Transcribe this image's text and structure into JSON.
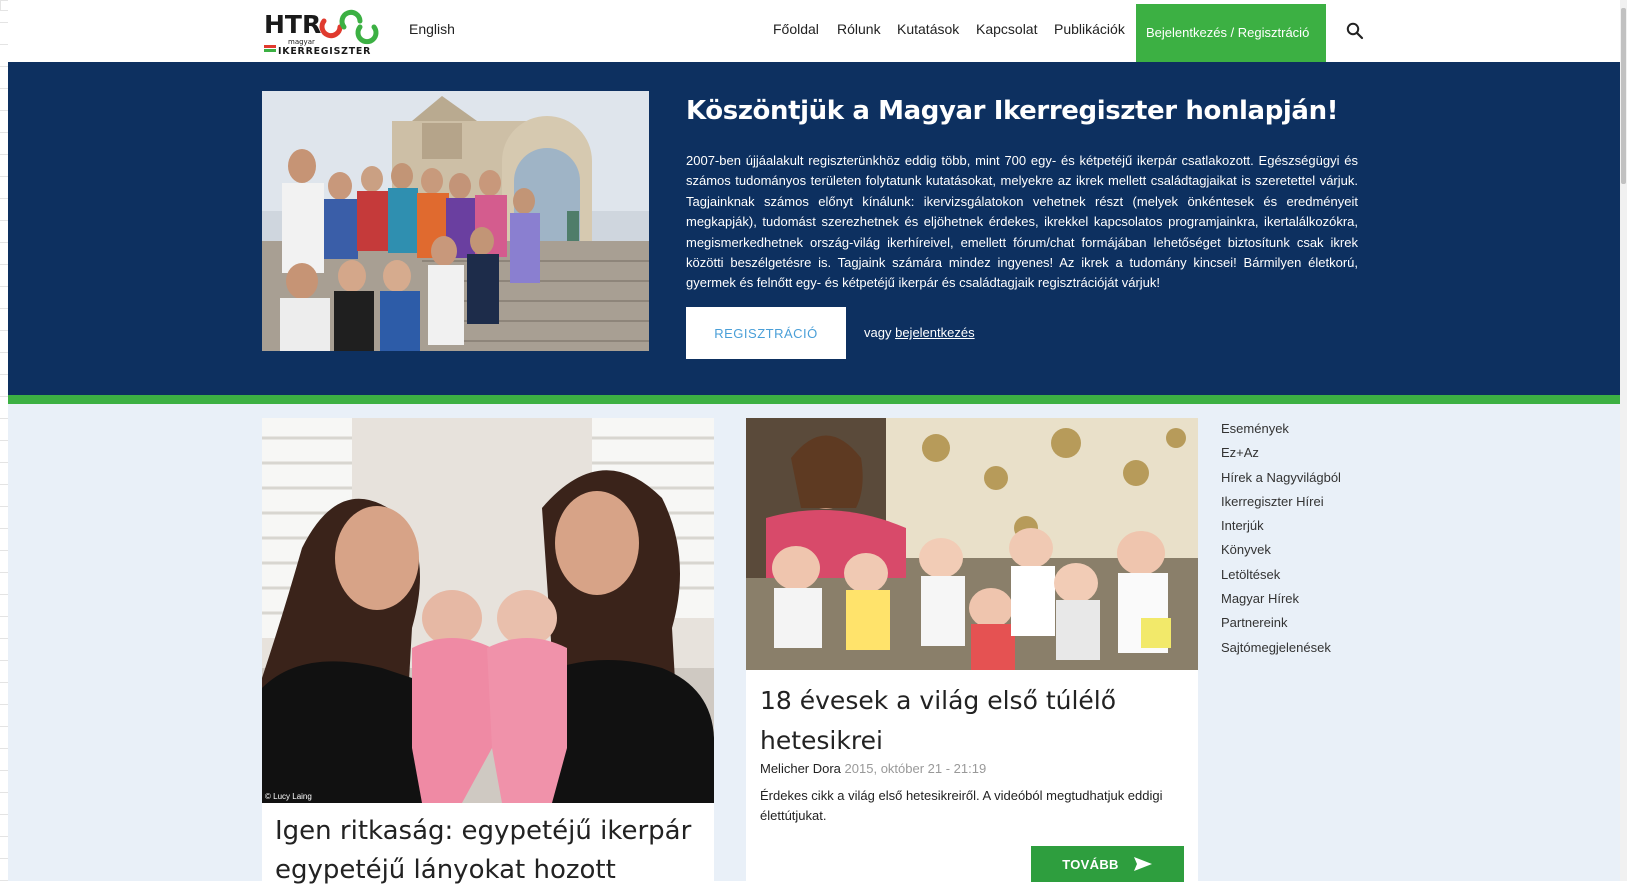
{
  "header": {
    "logo_text": "HTR",
    "logo_subtext_top": "magyar",
    "logo_subtext_bottom": "IKERREGISZTER",
    "language_link": "English",
    "nav": [
      {
        "label": "Főoldal"
      },
      {
        "label": "Rólunk"
      },
      {
        "label": "Kutatások"
      },
      {
        "label": "Kapcsolat"
      },
      {
        "label": "Publikációk"
      },
      {
        "label": "Bejelentkezés / Regisztráció"
      }
    ],
    "search_icon": "search-icon"
  },
  "hero": {
    "title": "Köszöntjük a Magyar Ikerregiszter honlapján!",
    "text": "2007-ben újjáalakult regiszterünkhöz eddig több, mint 700 egy- és kétpetéjű ikerpár csatlakozott. Egészségügyi és számos tudományos területen folytatunk kutatásokat, melyekre az ikrek mellett családtagjaikat is szeretettel várjuk. Tagjainknak számos előnyt kínálunk: ikervizsgálatokon vehetnek részt (melyek önkéntesek és eredményeit megkapják), tudomást szerezhetnek és eljöhetnek érdekes, ikrekkel kapcsolatos programjainkra, ikertalálkozókra, megismerkedhetnek ország-világ ikerhíreivel, emellett fórum/chat formájában lehetőséget biztosítunk csak ikrek közötti beszélgetésre is. Tagjaink számára mindez ingyenes! Az ikrek a tudomány kincsei! Bármilyen életkorú, gyermek és felnőtt egy- és kétpetéjű ikerpár és családtagjaik regisztrációját várjuk!",
    "register_button": "REGISZTRÁCIÓ",
    "or_text": "vagy",
    "login_link": "bejelentkezés"
  },
  "posts": [
    {
      "title": "Igen ritkaság: egypetéjű ikerpár egypetéjű lányokat hozott világra",
      "photo_credit": "© Lucy Laing"
    },
    {
      "title": "18 évesek a világ első túlélő hetesikrei",
      "author": "Melicher Dora",
      "date": "2015, október 21 - 21:19",
      "excerpt": "Érdekes cikk a világ első hetesikreiről. A videóból megtudhatjuk eddigi élettútjukat.",
      "more_button": "TOVÁBB"
    }
  ],
  "sidebar": {
    "categories": [
      "Események",
      "Ez+Az",
      "Hírek a Nagyvilágból",
      "Ikerregiszter Hírei",
      "Interjúk",
      "Könyvek",
      "Letöltések",
      "Magyar Hírek",
      "Partnereink",
      "Sajtómegjelenések"
    ]
  },
  "colors": {
    "hero_bg": "#0d3060",
    "accent_green": "#3cb043",
    "content_bg": "#e9f0f8",
    "register_text": "#4a9fd8"
  }
}
